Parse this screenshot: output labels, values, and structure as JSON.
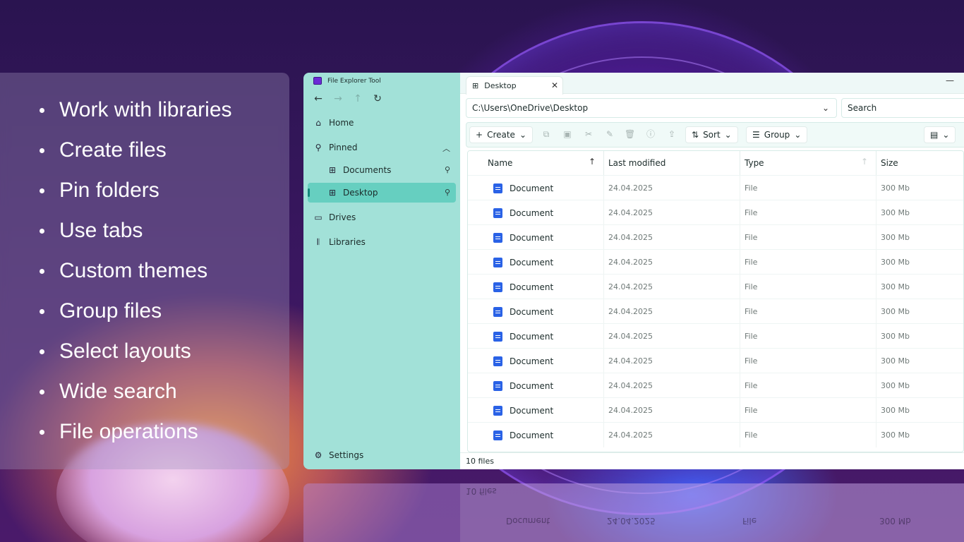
{
  "features": [
    "Work with libraries",
    "Create files",
    "Pin folders",
    "Use tabs",
    "Custom themes",
    "Group files",
    "Select layouts",
    "Wide search",
    "File operations"
  ],
  "app": {
    "title": "File Explorer Tool"
  },
  "nav": {
    "back_icon": "arrow-left-icon",
    "forward_icon": "arrow-right-icon",
    "up_icon": "arrow-up-icon",
    "refresh_icon": "refresh-icon"
  },
  "sidebar": {
    "home": "Home",
    "pinned": "Pinned",
    "pinned_items": [
      "Documents",
      "Desktop"
    ],
    "drives": "Drives",
    "libraries": "Libraries",
    "settings": "Settings"
  },
  "tab": {
    "label": "Desktop"
  },
  "address": {
    "path": "C:\\Users\\OneDrive\\Desktop"
  },
  "search": {
    "label": "Search"
  },
  "toolbar": {
    "create": "Create",
    "sort": "Sort",
    "group": "Group"
  },
  "table": {
    "headers": {
      "name": "Name",
      "modified": "Last modified",
      "type": "Type",
      "size": "Size"
    },
    "rows": [
      {
        "name": "Document",
        "modified": "24.04.2025",
        "type": "File",
        "size": "300 Mb"
      },
      {
        "name": "Document",
        "modified": "24.04.2025",
        "type": "File",
        "size": "300 Mb"
      },
      {
        "name": "Document",
        "modified": "24.04.2025",
        "type": "File",
        "size": "300 Mb"
      },
      {
        "name": "Document",
        "modified": "24.04.2025",
        "type": "File",
        "size": "300 Mb"
      },
      {
        "name": "Document",
        "modified": "24.04.2025",
        "type": "File",
        "size": "300 Mb"
      },
      {
        "name": "Document",
        "modified": "24.04.2025",
        "type": "File",
        "size": "300 Mb"
      },
      {
        "name": "Document",
        "modified": "24.04.2025",
        "type": "File",
        "size": "300 Mb"
      },
      {
        "name": "Document",
        "modified": "24.04.2025",
        "type": "File",
        "size": "300 Mb"
      },
      {
        "name": "Document",
        "modified": "24.04.2025",
        "type": "File",
        "size": "300 Mb"
      },
      {
        "name": "Document",
        "modified": "24.04.2025",
        "type": "File",
        "size": "300 Mb"
      },
      {
        "name": "Document",
        "modified": "24.04.2025",
        "type": "File",
        "size": "300 Mb"
      }
    ]
  },
  "status": {
    "count": "10 files"
  },
  "colors": {
    "sidebar": "#a2e1d8",
    "active": "#66cfc0",
    "doc_icon": "#2a62e6"
  }
}
